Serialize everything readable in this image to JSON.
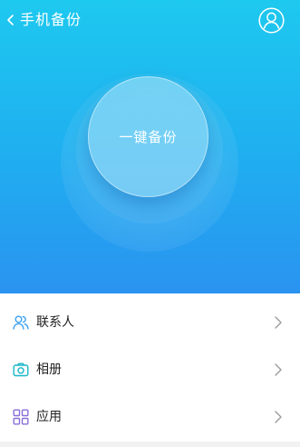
{
  "header": {
    "title": "手机备份",
    "back_icon": "back-icon",
    "user_icon": "user-icon"
  },
  "main": {
    "backup_button_label": "一键备份"
  },
  "list": {
    "items": [
      {
        "label": "联系人",
        "icon": "contacts-icon"
      },
      {
        "label": "相册",
        "icon": "camera-icon"
      },
      {
        "label": "应用",
        "icon": "apps-grid-icon"
      }
    ]
  },
  "colors": {
    "gradient_top": "#1ec9ef",
    "gradient_bottom": "#2a93f0",
    "icon_blue": "#3ba0f0",
    "icon_teal": "#19b6c8",
    "icon_purple": "#8b6fd8"
  }
}
